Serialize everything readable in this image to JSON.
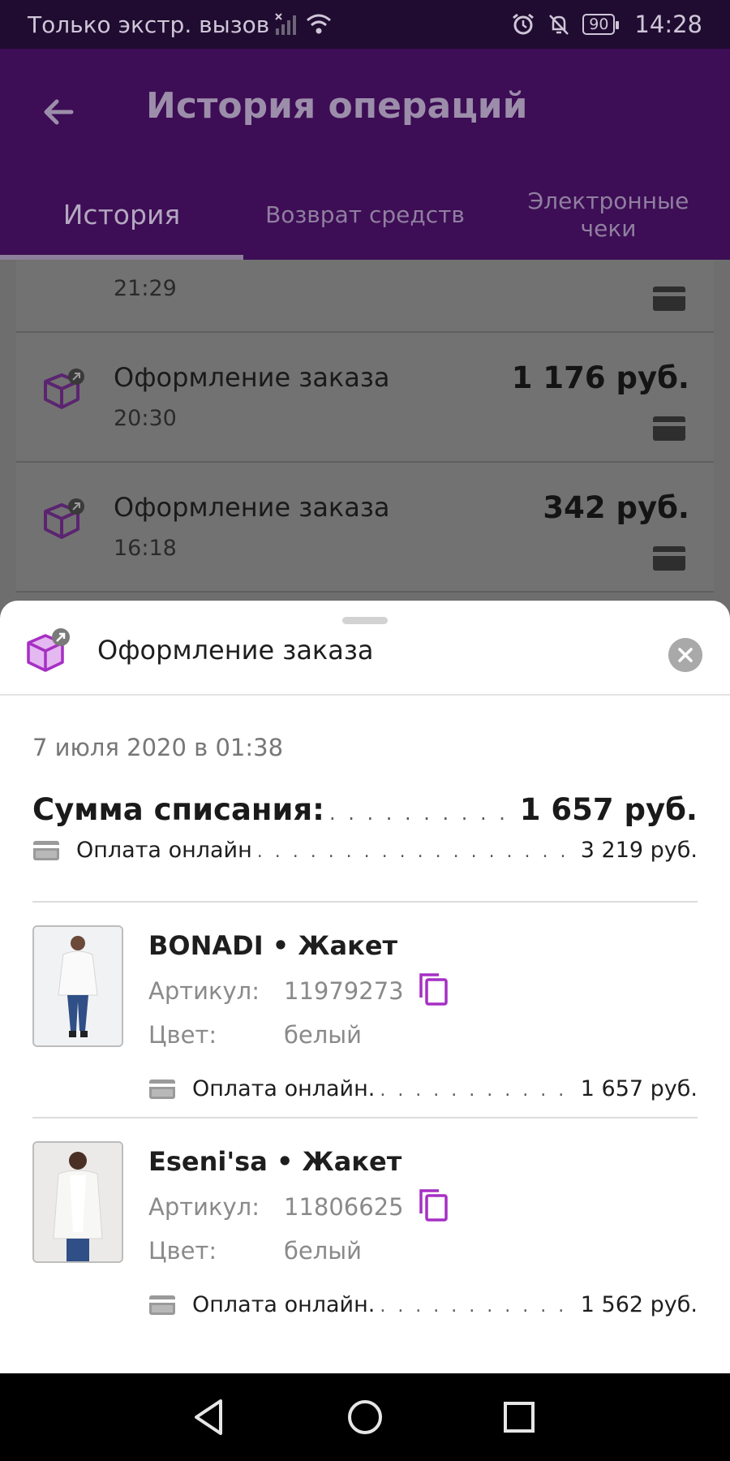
{
  "status_bar": {
    "carrier": "Только экстр. вызов",
    "battery": "90",
    "time": "14:28"
  },
  "app_bar": {
    "title": "История операций",
    "tabs": [
      {
        "label": "История"
      },
      {
        "label": "Возврат средств"
      },
      {
        "label": "Электронные чеки"
      }
    ]
  },
  "list": {
    "rows": [
      {
        "time": "21:29"
      },
      {
        "title": "Оформление заказа",
        "time": "20:30",
        "amount": "1 176 руб."
      },
      {
        "title": "Оформление заказа",
        "time": "16:18",
        "amount": "342 руб."
      }
    ]
  },
  "sheet": {
    "title": "Оформление заказа",
    "date": "7 июля 2020 в 01:38",
    "total_label": "Сумма списания:",
    "total_value": "1 657 руб.",
    "payment_label": "Оплата онлайн",
    "payment_value": "3 219 руб.",
    "items": [
      {
        "title": "BONADI • Жакет",
        "article_label": "Артикул:",
        "article": "11979273",
        "color_label": "Цвет:",
        "color": "белый",
        "pay_label": "Оплата онлайн.",
        "pay_value": "1 657 руб."
      },
      {
        "title": "Eseni'sa • Жакет",
        "article_label": "Артикул:",
        "article": "11806625",
        "color_label": "Цвет:",
        "color": "белый",
        "pay_label": "Оплата онлайн.",
        "pay_value": "1 562 руб."
      }
    ]
  },
  "colors": {
    "accent": "#9c27b0",
    "status_bar": "#1f0c30",
    "app_bar_dimmed": "#3d0d55"
  },
  "icons": [
    "back-arrow-icon",
    "box-icon",
    "card-icon",
    "copy-icon",
    "close-icon",
    "nav-back-icon",
    "nav-home-icon",
    "nav-recents-icon"
  ]
}
